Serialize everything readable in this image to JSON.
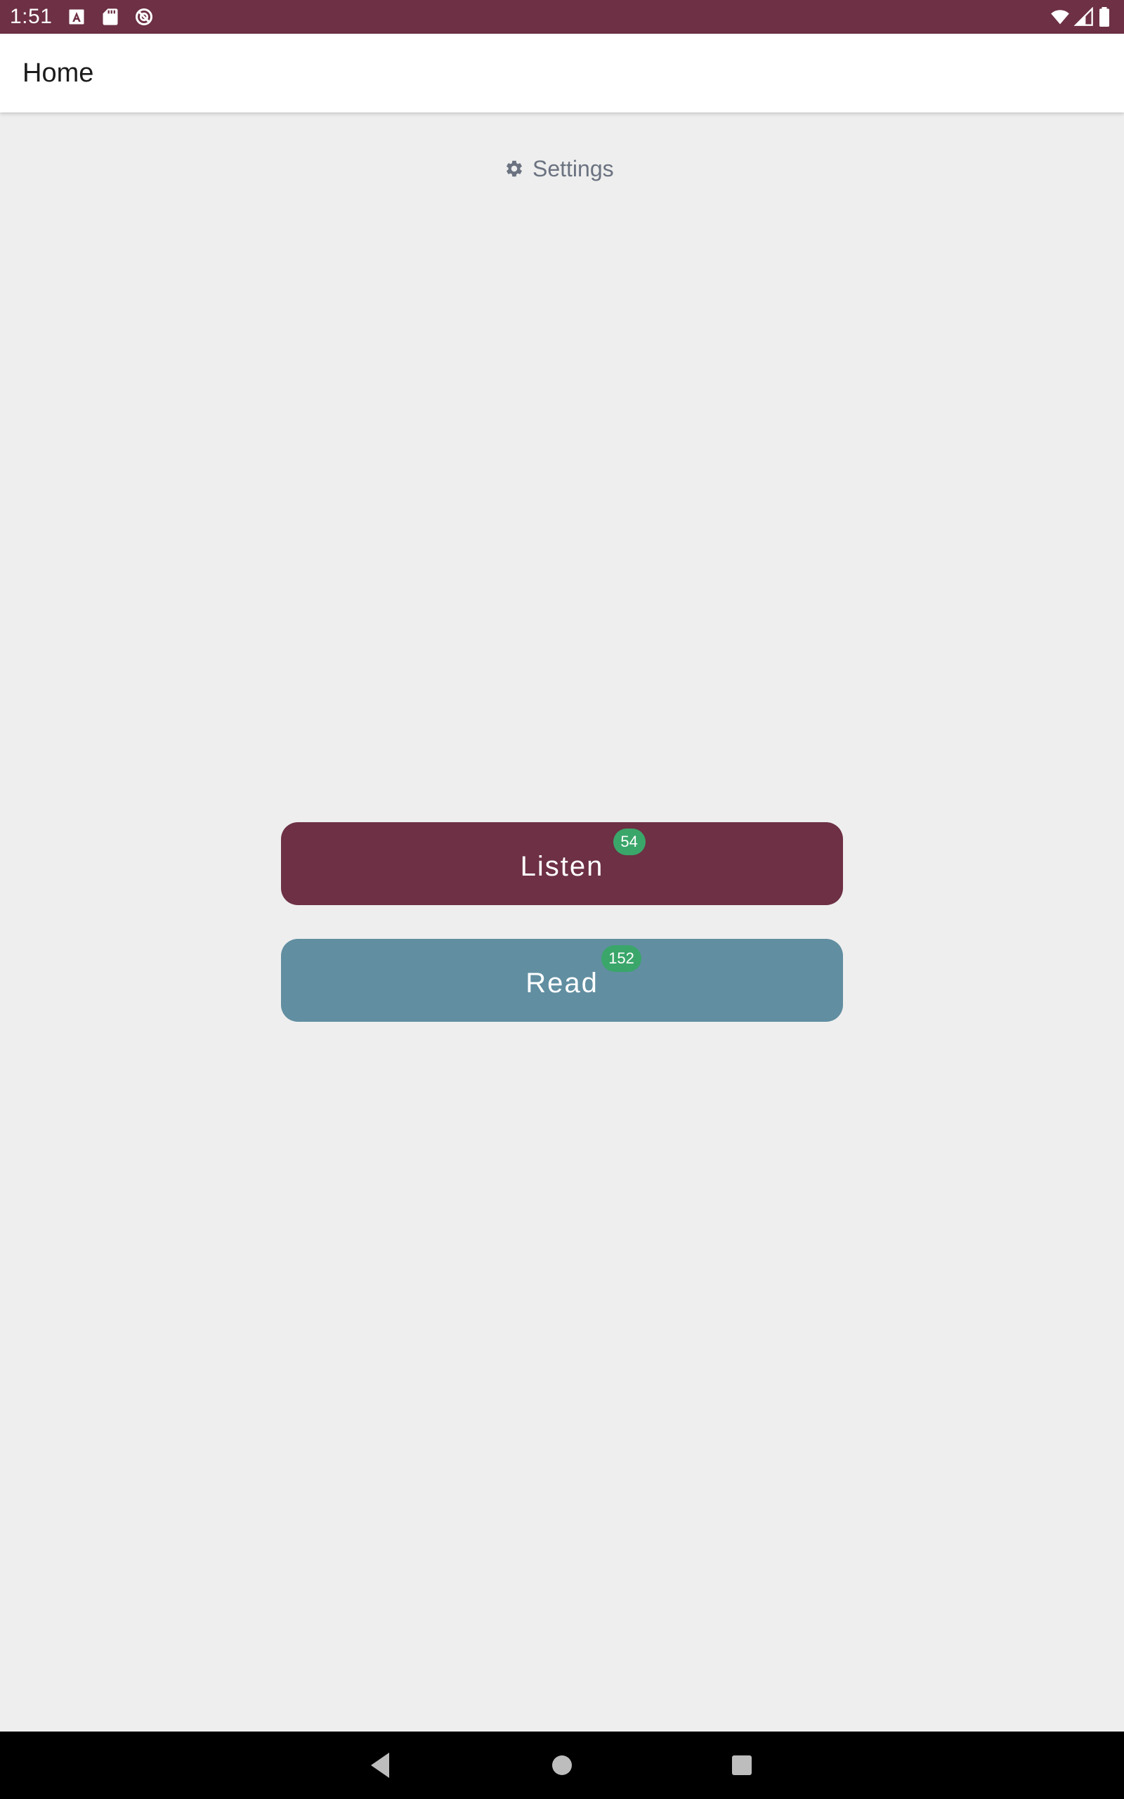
{
  "status_bar": {
    "time": "1:51",
    "background": "#6d3044",
    "left_icons": [
      "font-a-icon",
      "sd-card-icon",
      "no-sync-icon"
    ],
    "right_icons": [
      "wifi-icon",
      "cellular-signal-icon",
      "battery-icon"
    ]
  },
  "app_bar": {
    "title": "Home"
  },
  "settings": {
    "label": "Settings",
    "icon": "gear-icon"
  },
  "buttons": {
    "listen": {
      "label": "Listen",
      "badge": "54",
      "color": "#6d3044"
    },
    "read": {
      "label": "Read",
      "badge": "152",
      "color": "#618ea1"
    }
  },
  "badge_color": "#3aa66a",
  "nav_bar": {
    "buttons": [
      "back-icon",
      "home-icon",
      "recents-icon"
    ]
  }
}
